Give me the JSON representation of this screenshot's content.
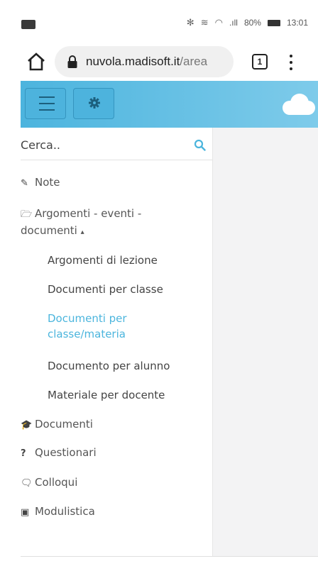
{
  "status_bar": {
    "signal": ".ıll",
    "battery": "80%",
    "time": "13:01"
  },
  "browser": {
    "url_host": "nuvola.madisoft.it",
    "url_path": "/area",
    "tab_count": "1"
  },
  "sidebar": {
    "search_placeholder": "Cerca..",
    "items": [
      {
        "label": "Note",
        "icon": "pin-icon"
      },
      {
        "label": "Argomenti - eventi -",
        "label_line2": "documenti",
        "caret": "▴",
        "icon": "folder-open-icon"
      },
      {
        "label": "Documenti",
        "icon": "graduation-cap-icon"
      },
      {
        "label": "Questionari",
        "icon": "question-icon"
      },
      {
        "label": "Colloqui",
        "icon": "chat-icon"
      },
      {
        "label": "Modulistica",
        "icon": "briefcase-icon"
      }
    ],
    "subitems": [
      {
        "label": "Argomenti di lezione"
      },
      {
        "label": "Documenti per classe"
      },
      {
        "label": "Documenti per classe/materia",
        "active": true
      },
      {
        "label": "Documento per alunno"
      },
      {
        "label": "Materiale per docente"
      }
    ]
  },
  "colors": {
    "accent": "#4bb5dd",
    "appbar_start": "#4cb4de",
    "appbar_end": "#7ecbea"
  }
}
